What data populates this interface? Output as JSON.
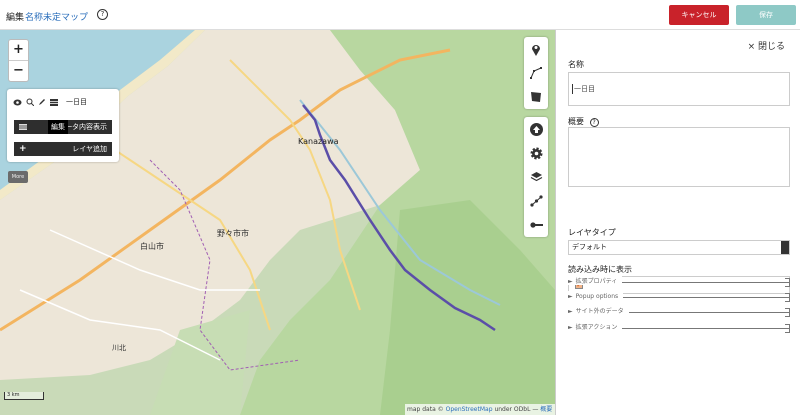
{
  "topbar": {
    "edit_label": "編集",
    "map_name": "名称未定マップ",
    "help": "?",
    "cancel_label": "キャンセル",
    "save_label": "保存"
  },
  "layers_panel": {
    "layer_name": "一日目",
    "table_label": "一タ内容表示",
    "tooltip": "編集",
    "add_layer_label": "レイヤ追加",
    "more_label": "More"
  },
  "map": {
    "city_label": "Kanazawa",
    "scale_label": "3 km",
    "attribution_prefix": "map data ©",
    "attribution_link": "OpenStreetMap",
    "attribution_suffix": "under ODbL —",
    "attribution_more": "概要",
    "zoom_in": "+",
    "zoom_out": "−",
    "place_labels": [
      "白山市",
      "野々市市",
      "川北"
    ]
  },
  "panel": {
    "close_label": "× 閉じる",
    "name_label": "名称",
    "name_value": "一日目",
    "description_label": "概要",
    "layer_type_label": "レイヤタイプ",
    "layer_type_value": "デフォルト",
    "display_on_load_label": "読み込み時に表示",
    "sections": [
      "拡張プロパティ",
      "Popup options",
      "サイト外のデータ",
      "拡張アクション"
    ]
  },
  "colors": {
    "cancel": "#c9222a",
    "save": "#8ec9c6",
    "route": "#5b4ea8",
    "link": "#2a6ebb"
  },
  "icons": [
    "eye-icon",
    "zoom-icon",
    "pencil-icon",
    "table-icon",
    "marker-icon",
    "polyline-icon",
    "polygon-icon",
    "upload-icon",
    "gear-icon",
    "layers-icon",
    "share-icon",
    "key-icon"
  ]
}
